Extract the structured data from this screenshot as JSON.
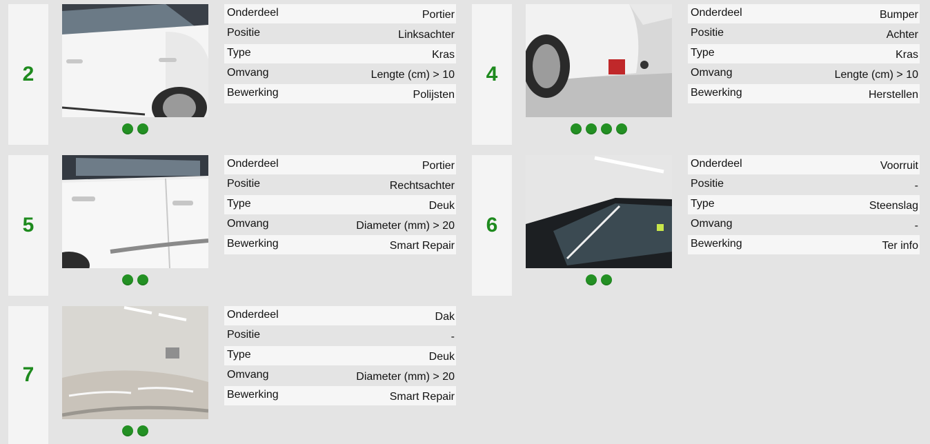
{
  "cards": [
    {
      "number": "2",
      "image_desc_icon": "car-door-photo",
      "dots": 2,
      "rows": [
        {
          "key": "Onderdeel",
          "value": "Portier"
        },
        {
          "key": "Positie",
          "value": "Linksachter"
        },
        {
          "key": "Type",
          "value": "Kras"
        },
        {
          "key": "Omvang",
          "value": "Lengte (cm) > 10"
        },
        {
          "key": "Bewerking",
          "value": "Polijsten"
        }
      ]
    },
    {
      "number": "4",
      "image_desc_icon": "car-bumper-photo",
      "dots": 4,
      "rows": [
        {
          "key": "Onderdeel",
          "value": "Bumper"
        },
        {
          "key": "Positie",
          "value": "Achter"
        },
        {
          "key": "Type",
          "value": "Kras"
        },
        {
          "key": "Omvang",
          "value": "Lengte (cm) > 10"
        },
        {
          "key": "Bewerking",
          "value": "Herstellen"
        }
      ]
    },
    {
      "number": "5",
      "image_desc_icon": "car-door-photo",
      "dots": 2,
      "rows": [
        {
          "key": "Onderdeel",
          "value": "Portier"
        },
        {
          "key": "Positie",
          "value": "Rechtsachter"
        },
        {
          "key": "Type",
          "value": "Deuk"
        },
        {
          "key": "Omvang",
          "value": "Diameter (mm) > 20"
        },
        {
          "key": "Bewerking",
          "value": "Smart Repair"
        }
      ]
    },
    {
      "number": "6",
      "image_desc_icon": "windshield-photo",
      "dots": 2,
      "rows": [
        {
          "key": "Onderdeel",
          "value": "Voorruit"
        },
        {
          "key": "Positie",
          "value": "-"
        },
        {
          "key": "Type",
          "value": "Steenslag"
        },
        {
          "key": "Omvang",
          "value": "-"
        },
        {
          "key": "Bewerking",
          "value": "Ter info"
        }
      ]
    },
    {
      "number": "7",
      "image_desc_icon": "car-roof-photo",
      "dots": 2,
      "rows": [
        {
          "key": "Onderdeel",
          "value": "Dak"
        },
        {
          "key": "Positie",
          "value": "-"
        },
        {
          "key": "Type",
          "value": "Deuk"
        },
        {
          "key": "Omvang",
          "value": "Diameter (mm) > 20"
        },
        {
          "key": "Bewerking",
          "value": "Smart Repair"
        }
      ]
    }
  ],
  "colors": {
    "number": "#1e8a1e",
    "dot": "#239023",
    "page_bg": "#e4e4e4"
  }
}
